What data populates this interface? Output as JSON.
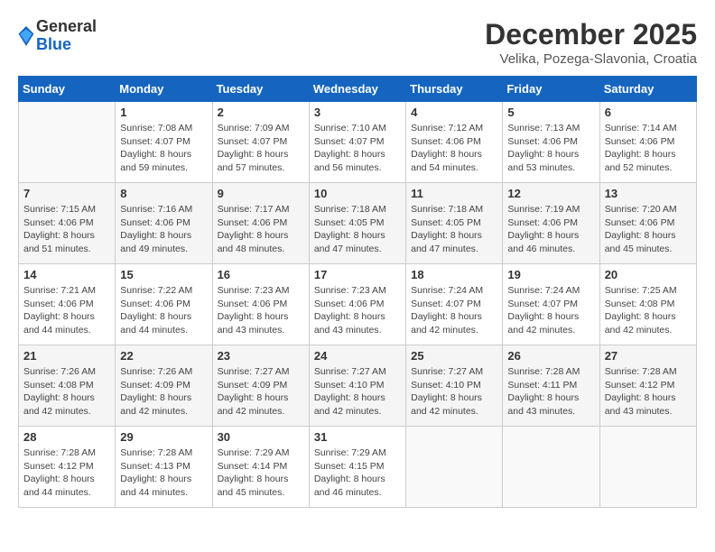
{
  "header": {
    "logo": {
      "general": "General",
      "blue": "Blue"
    },
    "month": "December 2025",
    "location": "Velika, Pozega-Slavonia, Croatia"
  },
  "weekdays": [
    "Sunday",
    "Monday",
    "Tuesday",
    "Wednesday",
    "Thursday",
    "Friday",
    "Saturday"
  ],
  "weeks": [
    [
      {
        "day": "",
        "info": ""
      },
      {
        "day": "1",
        "info": "Sunrise: 7:08 AM\nSunset: 4:07 PM\nDaylight: 8 hours\nand 59 minutes."
      },
      {
        "day": "2",
        "info": "Sunrise: 7:09 AM\nSunset: 4:07 PM\nDaylight: 8 hours\nand 57 minutes."
      },
      {
        "day": "3",
        "info": "Sunrise: 7:10 AM\nSunset: 4:07 PM\nDaylight: 8 hours\nand 56 minutes."
      },
      {
        "day": "4",
        "info": "Sunrise: 7:12 AM\nSunset: 4:06 PM\nDaylight: 8 hours\nand 54 minutes."
      },
      {
        "day": "5",
        "info": "Sunrise: 7:13 AM\nSunset: 4:06 PM\nDaylight: 8 hours\nand 53 minutes."
      },
      {
        "day": "6",
        "info": "Sunrise: 7:14 AM\nSunset: 4:06 PM\nDaylight: 8 hours\nand 52 minutes."
      }
    ],
    [
      {
        "day": "7",
        "info": "Sunrise: 7:15 AM\nSunset: 4:06 PM\nDaylight: 8 hours\nand 51 minutes."
      },
      {
        "day": "8",
        "info": "Sunrise: 7:16 AM\nSunset: 4:06 PM\nDaylight: 8 hours\nand 49 minutes."
      },
      {
        "day": "9",
        "info": "Sunrise: 7:17 AM\nSunset: 4:06 PM\nDaylight: 8 hours\nand 48 minutes."
      },
      {
        "day": "10",
        "info": "Sunrise: 7:18 AM\nSunset: 4:05 PM\nDaylight: 8 hours\nand 47 minutes."
      },
      {
        "day": "11",
        "info": "Sunrise: 7:18 AM\nSunset: 4:05 PM\nDaylight: 8 hours\nand 47 minutes."
      },
      {
        "day": "12",
        "info": "Sunrise: 7:19 AM\nSunset: 4:06 PM\nDaylight: 8 hours\nand 46 minutes."
      },
      {
        "day": "13",
        "info": "Sunrise: 7:20 AM\nSunset: 4:06 PM\nDaylight: 8 hours\nand 45 minutes."
      }
    ],
    [
      {
        "day": "14",
        "info": "Sunrise: 7:21 AM\nSunset: 4:06 PM\nDaylight: 8 hours\nand 44 minutes."
      },
      {
        "day": "15",
        "info": "Sunrise: 7:22 AM\nSunset: 4:06 PM\nDaylight: 8 hours\nand 44 minutes."
      },
      {
        "day": "16",
        "info": "Sunrise: 7:23 AM\nSunset: 4:06 PM\nDaylight: 8 hours\nand 43 minutes."
      },
      {
        "day": "17",
        "info": "Sunrise: 7:23 AM\nSunset: 4:06 PM\nDaylight: 8 hours\nand 43 minutes."
      },
      {
        "day": "18",
        "info": "Sunrise: 7:24 AM\nSunset: 4:07 PM\nDaylight: 8 hours\nand 42 minutes."
      },
      {
        "day": "19",
        "info": "Sunrise: 7:24 AM\nSunset: 4:07 PM\nDaylight: 8 hours\nand 42 minutes."
      },
      {
        "day": "20",
        "info": "Sunrise: 7:25 AM\nSunset: 4:08 PM\nDaylight: 8 hours\nand 42 minutes."
      }
    ],
    [
      {
        "day": "21",
        "info": "Sunrise: 7:26 AM\nSunset: 4:08 PM\nDaylight: 8 hours\nand 42 minutes."
      },
      {
        "day": "22",
        "info": "Sunrise: 7:26 AM\nSunset: 4:09 PM\nDaylight: 8 hours\nand 42 minutes."
      },
      {
        "day": "23",
        "info": "Sunrise: 7:27 AM\nSunset: 4:09 PM\nDaylight: 8 hours\nand 42 minutes."
      },
      {
        "day": "24",
        "info": "Sunrise: 7:27 AM\nSunset: 4:10 PM\nDaylight: 8 hours\nand 42 minutes."
      },
      {
        "day": "25",
        "info": "Sunrise: 7:27 AM\nSunset: 4:10 PM\nDaylight: 8 hours\nand 42 minutes."
      },
      {
        "day": "26",
        "info": "Sunrise: 7:28 AM\nSunset: 4:11 PM\nDaylight: 8 hours\nand 43 minutes."
      },
      {
        "day": "27",
        "info": "Sunrise: 7:28 AM\nSunset: 4:12 PM\nDaylight: 8 hours\nand 43 minutes."
      }
    ],
    [
      {
        "day": "28",
        "info": "Sunrise: 7:28 AM\nSunset: 4:12 PM\nDaylight: 8 hours\nand 44 minutes."
      },
      {
        "day": "29",
        "info": "Sunrise: 7:28 AM\nSunset: 4:13 PM\nDaylight: 8 hours\nand 44 minutes."
      },
      {
        "day": "30",
        "info": "Sunrise: 7:29 AM\nSunset: 4:14 PM\nDaylight: 8 hours\nand 45 minutes."
      },
      {
        "day": "31",
        "info": "Sunrise: 7:29 AM\nSunset: 4:15 PM\nDaylight: 8 hours\nand 46 minutes."
      },
      {
        "day": "",
        "info": ""
      },
      {
        "day": "",
        "info": ""
      },
      {
        "day": "",
        "info": ""
      }
    ]
  ]
}
